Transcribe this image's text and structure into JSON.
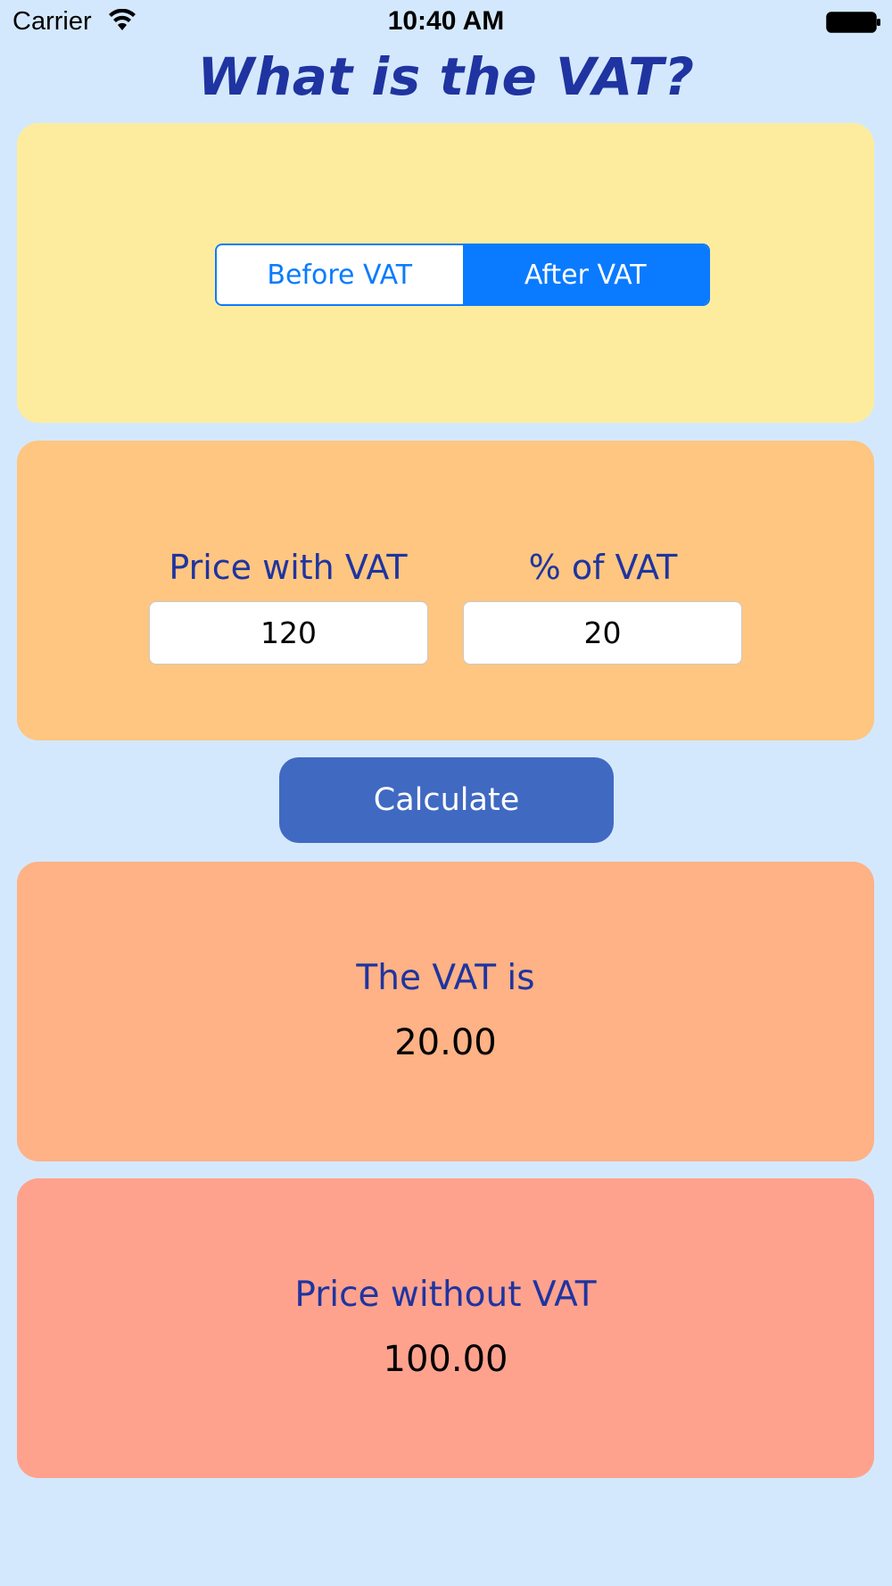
{
  "status_bar": {
    "carrier": "Carrier",
    "time": "10:40 AM",
    "wifi_icon": "wifi-icon",
    "battery_icon": "battery-icon"
  },
  "title": "What is the VAT?",
  "mode": {
    "options": [
      "Before VAT",
      "After VAT"
    ],
    "selected": "After VAT",
    "accent_color": "#0a7bff"
  },
  "inputs": {
    "price_label": "Price with VAT",
    "price_value": "120",
    "vat_percent_label": "% of VAT",
    "vat_percent_value": "20"
  },
  "calculate_label": "Calculate",
  "results": {
    "vat_label": "The VAT is",
    "vat_value": "20.00",
    "price_label": "Price without VAT",
    "price_value": "100.00"
  },
  "colors": {
    "background": "#d4e8fd",
    "title": "#1f34a0",
    "mode_panel": "#feec9e",
    "inputs_panel": "#fec680",
    "vat_panel": "#feb285",
    "price_panel": "#fea28d",
    "button": "#4069c2"
  }
}
